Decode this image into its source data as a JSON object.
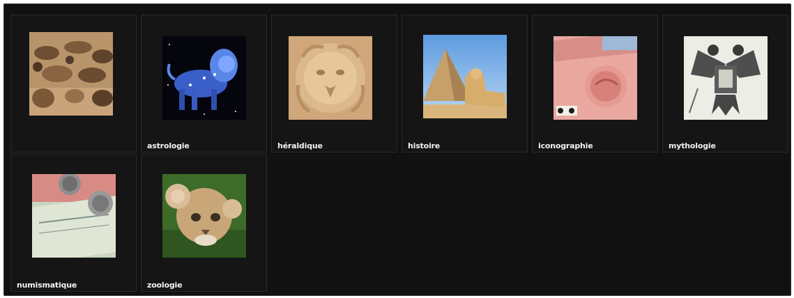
{
  "gallery": {
    "tiles": [
      {
        "label": "",
        "icon": "sea-lions-image"
      },
      {
        "label": "astrologie",
        "icon": "zodiac-lion-image"
      },
      {
        "label": "héraldique",
        "icon": "carved-lion-head-image"
      },
      {
        "label": "histoire",
        "icon": "sphinx-pyramid-image"
      },
      {
        "label": "iconographie",
        "icon": "banknote-lion-image"
      },
      {
        "label": "mythologie",
        "icon": "double-headed-eagle-image"
      },
      {
        "label": "numismatique",
        "icon": "coins-banknotes-image"
      },
      {
        "label": "zoologie",
        "icon": "lion-cub-image"
      }
    ]
  }
}
